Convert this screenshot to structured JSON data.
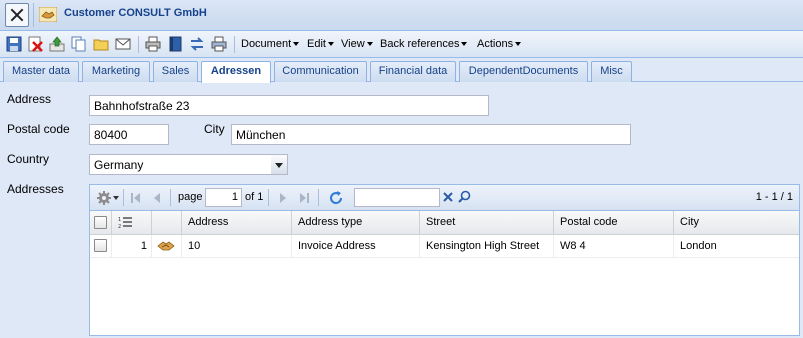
{
  "window": {
    "title": "Customer CONSULT GmbH"
  },
  "toolbar": {
    "menus": [
      "Document",
      "Edit",
      "View",
      "Back references",
      "Actions"
    ]
  },
  "tabs": [
    "Master data",
    "Marketing",
    "Sales",
    "Adressen",
    "Communication",
    "Financial data",
    "DependentDocuments",
    "Misc"
  ],
  "active_tab": "Adressen",
  "form": {
    "address_label": "Address",
    "address_value": "Bahnhofstraße 23",
    "postal_label": "Postal code",
    "postal_value": "80400",
    "city_label": "City",
    "city_value": "München",
    "country_label": "Country",
    "country_value": "Germany",
    "addresses_label": "Addresses"
  },
  "grid": {
    "pager": {
      "page_label": "page",
      "page_value": "1",
      "of_label": "of 1",
      "count": "1 - 1 / 1"
    },
    "columns": [
      "Address",
      "Address type",
      "Street",
      "Postal code",
      "City"
    ],
    "rows": [
      {
        "num": "1",
        "address": "10",
        "type": "Invoice Address",
        "street": "Kensington High Street",
        "postal": "W8 4",
        "city": "London"
      }
    ]
  },
  "colors": {
    "accent": "#15428b",
    "border": "#99bbe8",
    "background": "#dfe8f6"
  }
}
